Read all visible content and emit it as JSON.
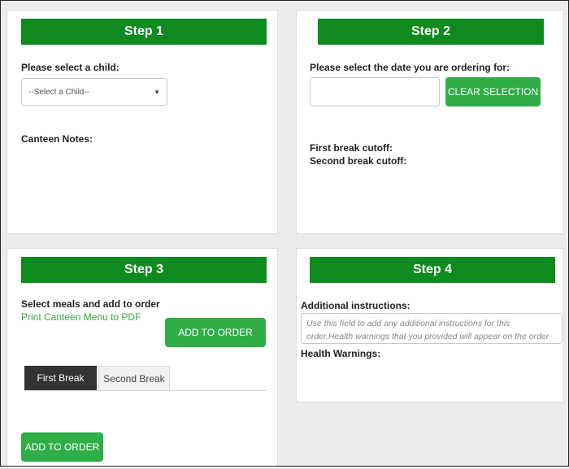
{
  "step1": {
    "title": "Step 1",
    "child_label": "Please select a child:",
    "child_select_value": "--Select a Child--",
    "notes_label": "Canteen Notes:"
  },
  "step2": {
    "title": "Step 2",
    "date_label": "Please select the date you are ordering for:",
    "date_value": "",
    "clear_button": "CLEAR SELECTION",
    "first_cutoff": "First break cutoff:",
    "second_cutoff": "Second break cutoff:"
  },
  "step3": {
    "title": "Step 3",
    "meals_label": "Select meals and add to order",
    "print_link": "Print Canteen Menu to PDF",
    "add_button_top": "ADD TO ORDER",
    "tabs": [
      {
        "label": "First Break",
        "active": true
      },
      {
        "label": "Second Break",
        "active": false
      }
    ],
    "add_button_bottom": "ADD TO ORDER"
  },
  "step4": {
    "title": "Step 4",
    "instructions_label": "Additional instructions:",
    "instructions_placeholder": "Use this field to add any additional instructions for this order,Health warnings that you provided will appear on the order by default.",
    "health_label": "Health Warnings:"
  },
  "colors": {
    "step_bar": "#0e8a1e",
    "button": "#2fae48",
    "link": "#3aa83f",
    "active_tab": "#333333"
  },
  "icons": {
    "select_arrow": "triangle-down-icon"
  }
}
